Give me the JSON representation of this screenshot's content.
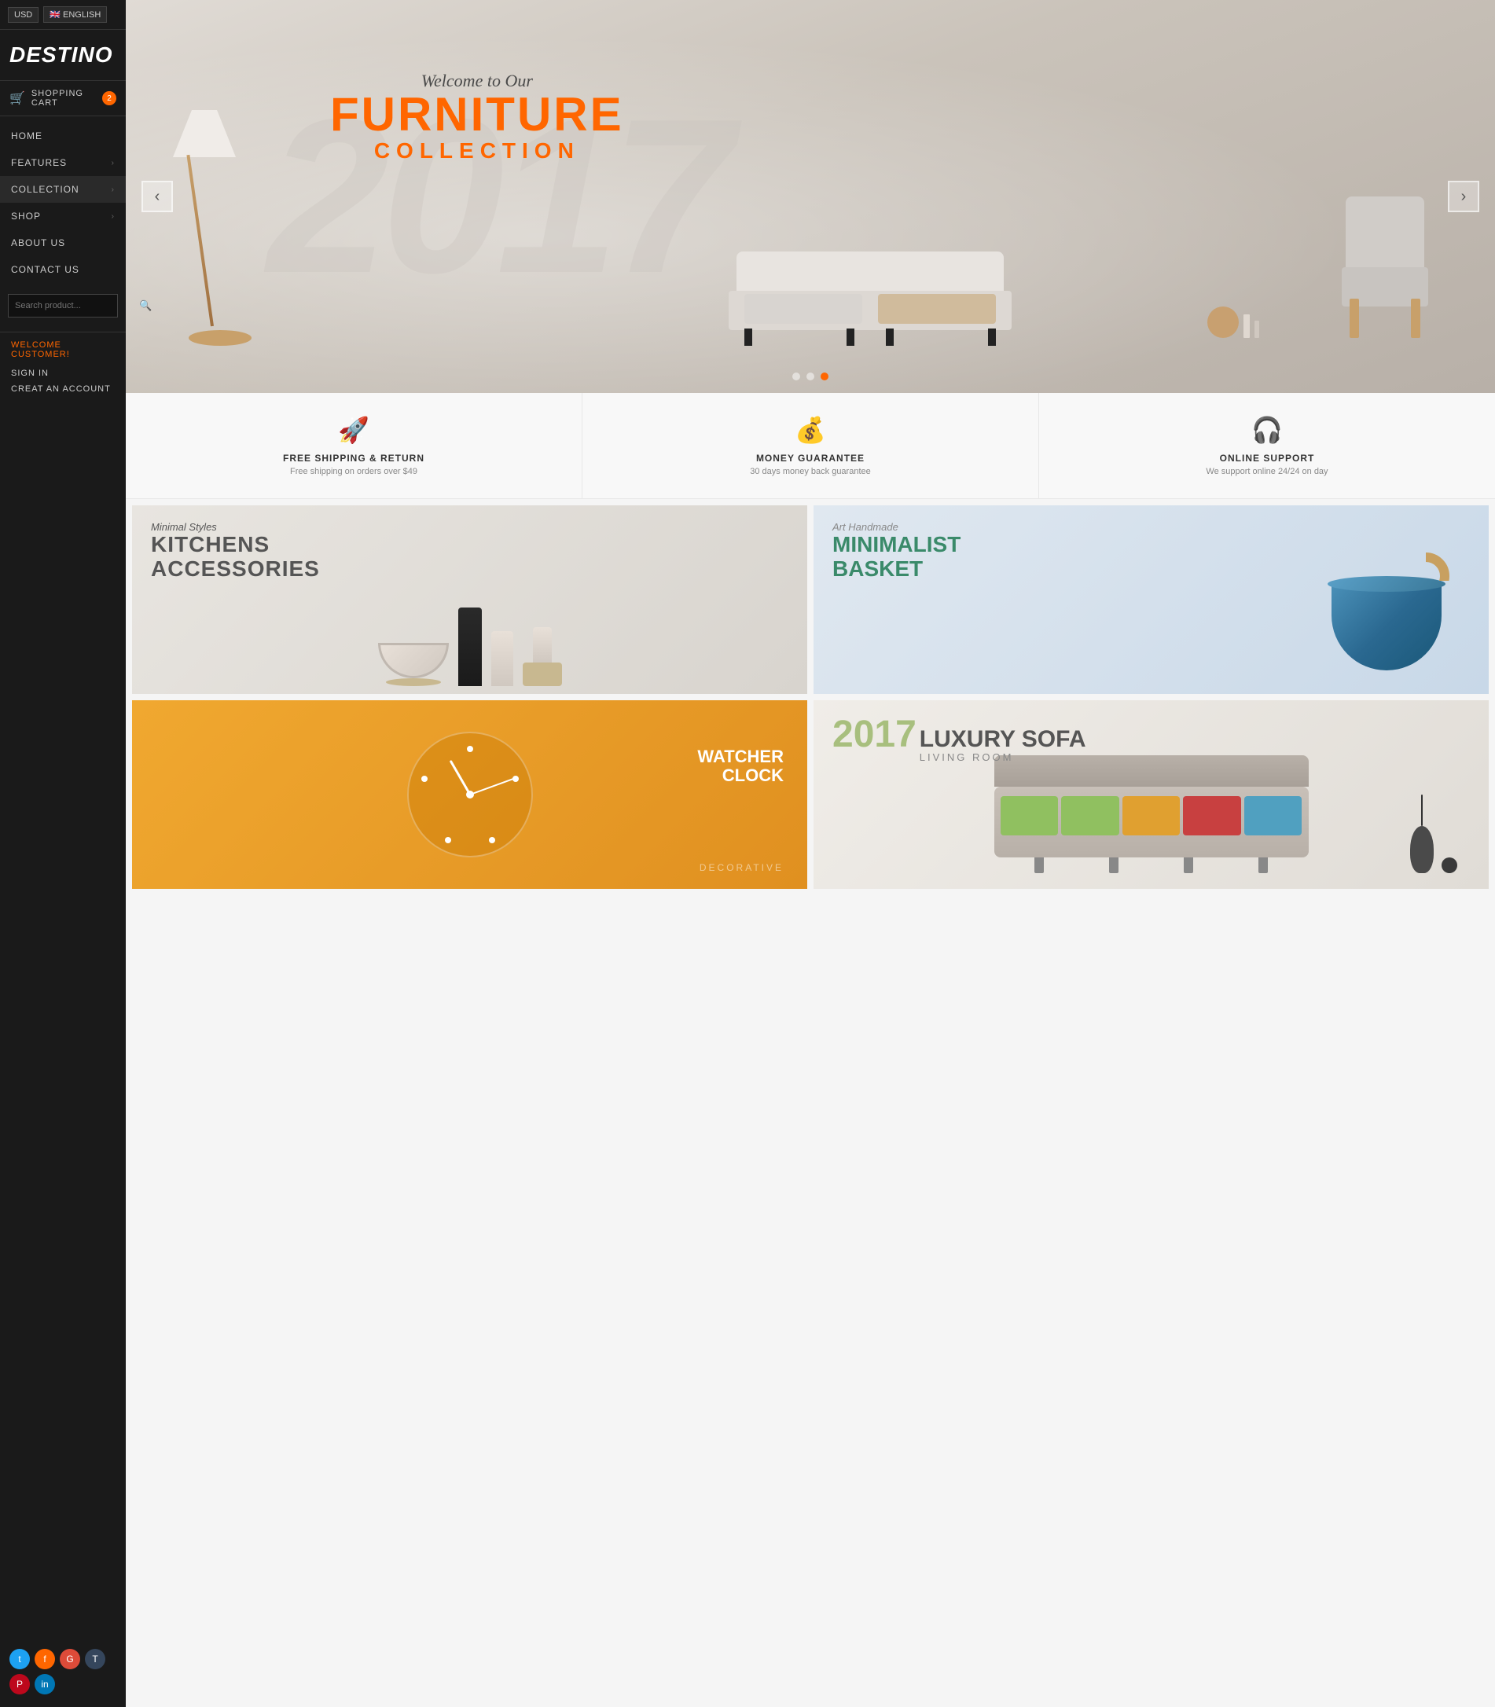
{
  "topbar": {
    "currency": "USD",
    "language": "🇬🇧 ENGLISH"
  },
  "logo": {
    "text_colored": "DESTIN",
    "text_white": "O"
  },
  "cart": {
    "label": "SHOPPING CART",
    "count": "2"
  },
  "nav": {
    "items": [
      {
        "label": "HOME",
        "has_arrow": false
      },
      {
        "label": "FEATURES",
        "has_arrow": true
      },
      {
        "label": "COLLECTION",
        "has_arrow": true,
        "active": true
      },
      {
        "label": "SHOP",
        "has_arrow": true
      },
      {
        "label": "ABOUT US",
        "has_arrow": false
      },
      {
        "label": "CONTACT US",
        "has_arrow": false
      }
    ]
  },
  "search": {
    "placeholder": "Search product..."
  },
  "user": {
    "welcome": "WELCOME CUSTOMER!",
    "sign_in": "SIGN IN",
    "create": "CREAT AN ACCOUNT"
  },
  "social": [
    {
      "name": "twitter",
      "class": "si-twitter",
      "symbol": "t"
    },
    {
      "name": "facebook",
      "class": "si-facebook",
      "symbol": "f"
    },
    {
      "name": "google",
      "class": "si-google",
      "symbol": "G"
    },
    {
      "name": "tumblr",
      "class": "si-tumblr",
      "symbol": "T"
    },
    {
      "name": "pinterest",
      "class": "si-pinterest",
      "symbol": "P"
    },
    {
      "name": "linkedin",
      "class": "si-linkedin",
      "symbol": "in"
    }
  ],
  "hero": {
    "welcome": "Welcome to Our",
    "line1": "FURNITURE",
    "line2": "COLLECTION",
    "year": "2017",
    "dots": 3,
    "active_dot": 2
  },
  "features": [
    {
      "icon": "🚀",
      "title": "FREE SHIPPING & RETURN",
      "subtitle": "Free shipping on orders over $49"
    },
    {
      "icon": "💰",
      "title": "MONEY GUARANTEE",
      "subtitle": "30 days money back guarantee"
    },
    {
      "icon": "🎧",
      "title": "ONLINE SUPPORT",
      "subtitle": "We support online 24/24 on day"
    }
  ],
  "products": [
    {
      "sub_title": "Minimal Styles",
      "main_title": "KITCHENS\nACCESSORIES",
      "type": "kitchen"
    },
    {
      "sub_title": "Art Handmade",
      "main_title": "MINIMALIST\nBASKET",
      "type": "basket"
    },
    {
      "sub_title": "WATCHER\nCLOCK",
      "main_title": "",
      "decorative": "DECORATIVE",
      "type": "clock"
    },
    {
      "year": "2017",
      "main_title": "LUXURY SOFA",
      "sub_title": "LIVING ROOM",
      "type": "sofa"
    }
  ]
}
